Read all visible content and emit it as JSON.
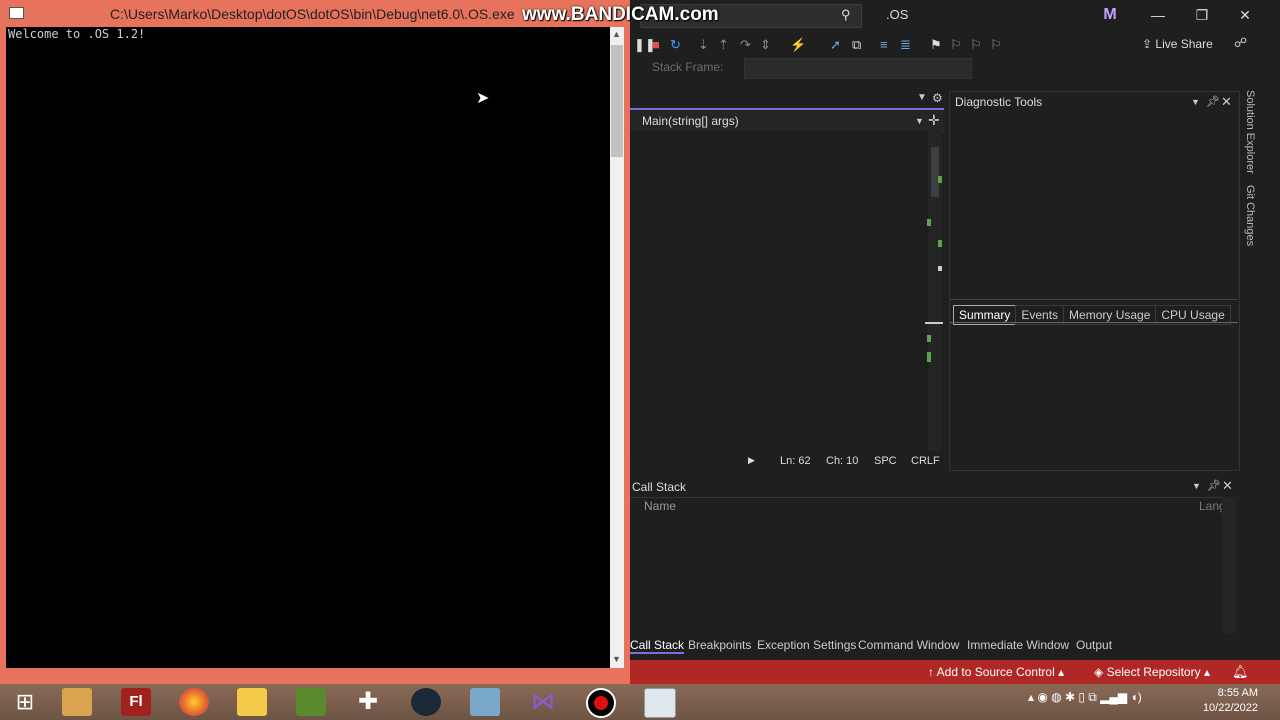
{
  "console": {
    "title": "C:\\Users\\Marko\\Desktop\\dotOS\\dotOS\\bin\\Debug\\net6.0\\.OS.exe",
    "output": "Welcome to .OS 1.2!"
  },
  "watermark": "www.BANDICAM.com",
  "vs": {
    "solution_name": ".OS",
    "avatar_letter": "M",
    "live_share": "Live Share",
    "stack_frame_label": "Stack Frame:",
    "nav_method": "Main(string[] args)",
    "status": {
      "ln": "Ln: 62",
      "ch": "Ch: 10",
      "spc": "SPC",
      "crlf": "CRLF"
    },
    "diagnostic_tools": {
      "title": "Diagnostic Tools",
      "tabs": [
        "Summary",
        "Events",
        "Memory Usage",
        "CPU Usage"
      ]
    },
    "side_tabs": [
      "Solution Explorer",
      "Git Changes"
    ],
    "call_stack": {
      "title": "Call Stack",
      "col_name": "Name",
      "col_lang": "Lang"
    },
    "bottom_tabs": [
      "Call Stack",
      "Breakpoints",
      "Exception Settings",
      "Command Window",
      "Immediate Window",
      "Output"
    ],
    "statusbar": {
      "source_control": "Add to Source Control",
      "repo": "Select Repository"
    }
  },
  "taskbar": {
    "time": "8:55 AM",
    "date": "10/22/2022",
    "apps": [
      "windows-start",
      "file-explorer-old",
      "flash",
      "firefox",
      "folder",
      "minecraft",
      "slack",
      "steam",
      "game-app",
      "visual-studio",
      "record",
      "notepad"
    ]
  },
  "colors": {
    "console_border": "#e8735c",
    "vs_statusbar": "#b02825",
    "accent": "#7a6fe0"
  }
}
